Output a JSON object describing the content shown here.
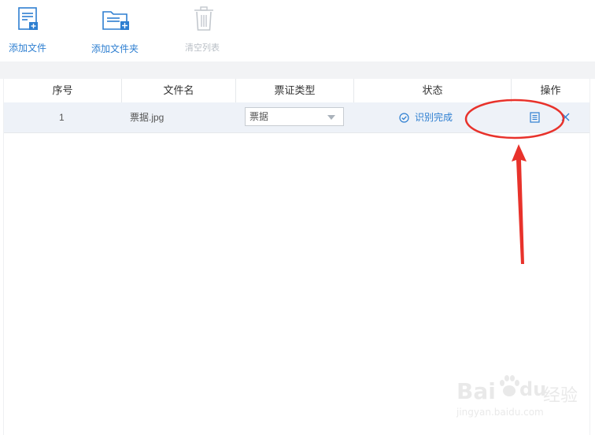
{
  "toolbar": {
    "add_file": {
      "label": "添加文件",
      "icon": "add-file-icon"
    },
    "add_folder": {
      "label": "添加文件夹",
      "icon": "add-folder-icon"
    },
    "clear_list": {
      "label": "清空列表",
      "icon": "trash-icon",
      "enabled": false
    }
  },
  "table": {
    "columns": [
      "序号",
      "文件名",
      "票证类型",
      "状态",
      "操作"
    ],
    "rows": [
      {
        "index": "1",
        "filename": "票据.jpg",
        "type": "票据",
        "status": "识别完成",
        "actions": [
          "view-result-icon",
          "delete-icon"
        ]
      }
    ]
  },
  "watermark": {
    "brand": "Bai",
    "brand2": "du",
    "suffix": "经验",
    "url": "jingyan.baidu.com"
  },
  "colors": {
    "accent": "#2e7fd1",
    "disabled": "#b9bfc6",
    "row_bg": "#eef2f8",
    "annotation": "#e8322b"
  }
}
